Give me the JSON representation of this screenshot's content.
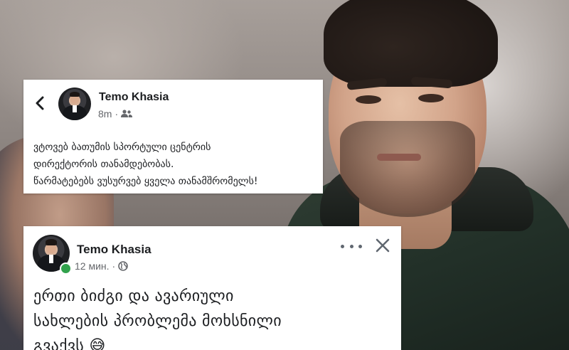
{
  "post_old": {
    "author": "Temo Khasia",
    "time": "8m",
    "separator": "·",
    "audience_icon": "friends-icon",
    "text_lines": [
      "ვტოვებ ბათუმის სპორტული ცენტრის",
      "დირექტორის თანამდებობას.",
      "წარმატებებს ვუსურვებ ყველა თანამშრომელს!"
    ]
  },
  "post_new": {
    "author": "Temo Khasia",
    "time": "12 мин.",
    "separator": "·",
    "audience_icon": "globe-icon",
    "text_lines": [
      "ერთი ბიძგი და ავარიული",
      "სახლების პრობლემა მოხსნილი",
      "გვაქვს 😅"
    ]
  },
  "colors": {
    "card_bg": "#ffffff",
    "name_text": "#1c1e21",
    "meta_text": "#65676b",
    "online_dot": "#31a24c"
  }
}
